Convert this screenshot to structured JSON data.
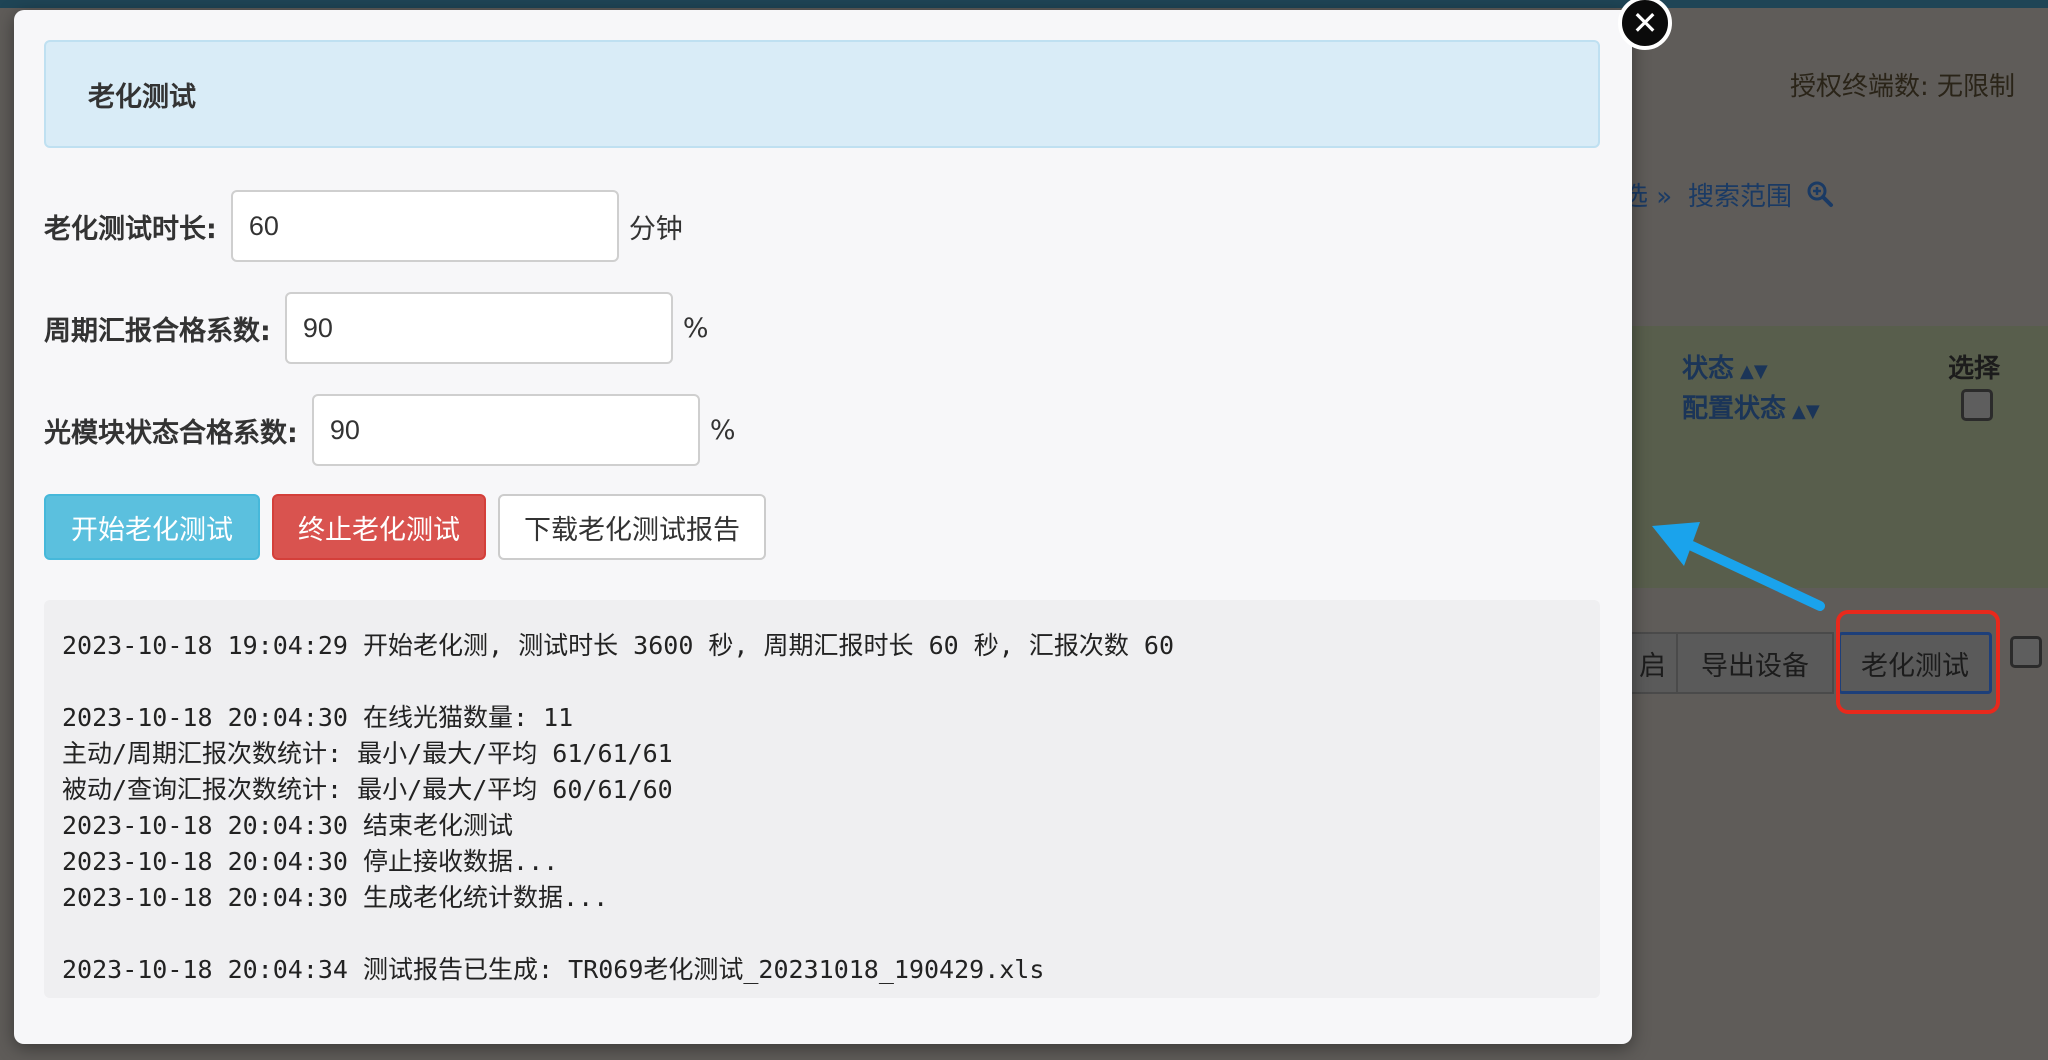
{
  "background": {
    "license_label": "授权终端数: 无限制",
    "filter_link": "选 »",
    "search_scope_link": "搜索范围",
    "table_headers": {
      "status": "状态",
      "config_status": "配置状态",
      "select": "选择"
    },
    "buttons": {
      "partial_restart": "启",
      "export_devices": "导出设备",
      "aging_test": "老化测试"
    }
  },
  "modal": {
    "title": "老化测试",
    "close_icon": "close-icon",
    "fields": {
      "duration": {
        "label": "老化测试时长:",
        "value": "60",
        "unit": "分钟"
      },
      "periodic_ratio": {
        "label": "周期汇报合格系数:",
        "value": "90",
        "unit": "%"
      },
      "optical_ratio": {
        "label": "光模块状态合格系数:",
        "value": "90",
        "unit": "%"
      }
    },
    "buttons": {
      "start": "开始老化测试",
      "stop": "终止老化测试",
      "download": "下载老化测试报告"
    },
    "log_lines": [
      "2023-10-18 19:04:29 开始老化测, 测试时长 3600 秒, 周期汇报时长 60 秒, 汇报次数 60",
      "",
      "2023-10-18 20:04:30 在线光猫数量: 11",
      "主动/周期汇报次数统计: 最小/最大/平均 61/61/61",
      "被动/查询汇报次数统计: 最小/最大/平均 60/61/60",
      "2023-10-18 20:04:30 结束老化测试",
      "2023-10-18 20:04:30 停止接收数据...",
      "2023-10-18 20:04:30 生成老化统计数据...",
      "",
      "2023-10-18 20:04:34 测试报告已生成: TR069老化测试_20231018_190429.xls"
    ]
  },
  "colors": {
    "start_button": "#5bc0de",
    "stop_button": "#d9534f",
    "header_bg": "#d9ecf7",
    "annotation_red": "#e8291c",
    "annotation_arrow": "#1aa3ec"
  }
}
